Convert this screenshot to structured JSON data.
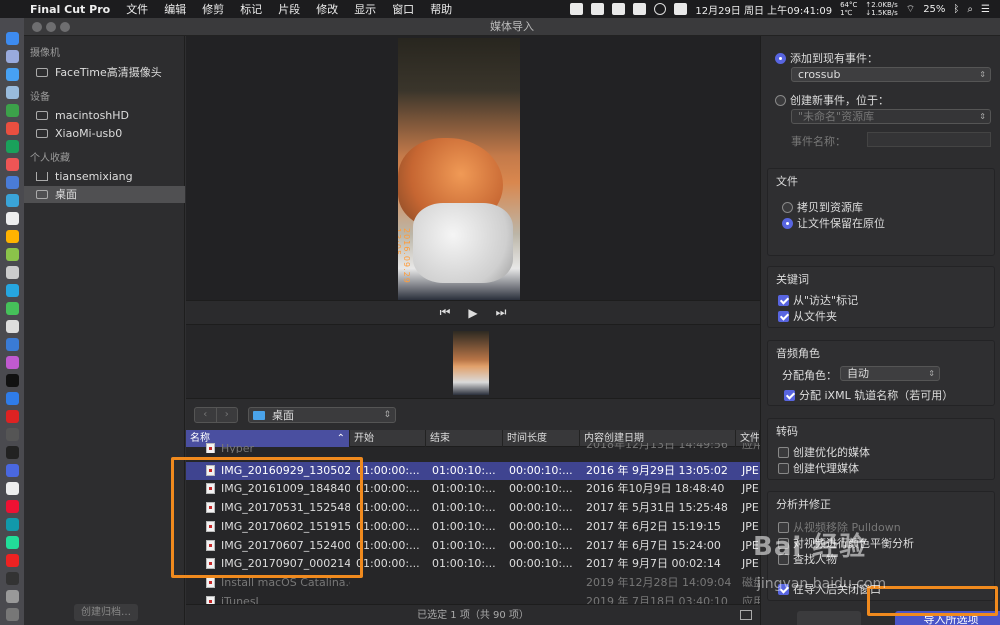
{
  "menubar": {
    "app_name": "Final Cut Pro",
    "items": [
      "文件",
      "编辑",
      "修剪",
      "标记",
      "片段",
      "修改",
      "显示",
      "窗口",
      "帮助"
    ],
    "temp": "64°C",
    "fan": "1℃",
    "net_up": "↑2.0KB/s",
    "net_down": "↓1.5KB/s",
    "datetime": "12月29日 周日 上午09:41:09",
    "battery": "25%"
  },
  "window": {
    "title": "媒体导入"
  },
  "sidebar": {
    "sections": [
      {
        "heading": "摄像机",
        "items": [
          {
            "label": "FaceTime高清摄像头",
            "icon": "camera-icon"
          }
        ]
      },
      {
        "heading": "设备",
        "items": [
          {
            "label": "macintoshHD",
            "icon": "drive-icon"
          },
          {
            "label": "XiaoMi-usb0",
            "icon": "drive-icon"
          }
        ]
      },
      {
        "heading": "个人收藏",
        "items": [
          {
            "label": "tiansemixiang",
            "icon": "home-icon"
          },
          {
            "label": "桌面",
            "icon": "desktop-icon",
            "selected": true
          }
        ]
      }
    ],
    "footer_button": "创建归档…"
  },
  "preview": {
    "date_stamp": "2016.09.29 13:05"
  },
  "transport": {
    "prev": "⏮",
    "play": "▶",
    "next": "⏭"
  },
  "browser": {
    "back": "‹",
    "forward": "›",
    "folder": "桌面",
    "columns": [
      "名称",
      "开始",
      "结束",
      "时间长度",
      "内容创建日期",
      "文件"
    ],
    "rows": [
      {
        "name": "Hyper",
        "start": "",
        "end": "",
        "duration": "",
        "date": "2018年12月13日 14:49:56",
        "type": "应用",
        "dim": true
      },
      {
        "name": "IMG_20160929_130502...",
        "start": "01:00:00:...",
        "end": "01:00:10:...",
        "duration": "00:00:10:...",
        "date": "2016 年 9月29日 13:05:02",
        "type": "JPE",
        "selected": true
      },
      {
        "name": "IMG_20161009_184840...",
        "start": "01:00:00:...",
        "end": "01:00:10:...",
        "duration": "00:00:10:...",
        "date": "2016 年10月9日 18:48:40",
        "type": "JPE"
      },
      {
        "name": "IMG_20170531_152548_...",
        "start": "01:00:00:...",
        "end": "01:00:10:...",
        "duration": "00:00:10:...",
        "date": "2017 年 5月31日 15:25:48",
        "type": "JPE"
      },
      {
        "name": "IMG_20170602_151915_...",
        "start": "01:00:00:...",
        "end": "01:00:10:...",
        "duration": "00:00:10:...",
        "date": "2017 年 6月2日 15:19:15",
        "type": "JPE"
      },
      {
        "name": "IMG_20170607_152400_...",
        "start": "01:00:00:...",
        "end": "01:00:10:...",
        "duration": "00:00:10:...",
        "date": "2017 年 6月7日 15:24:00",
        "type": "JPE"
      },
      {
        "name": "IMG_20170907_000214_...",
        "start": "01:00:00:...",
        "end": "01:00:10:...",
        "duration": "00:00:10:...",
        "date": "2017 年 9月7日 00:02:14",
        "type": "JPE"
      },
      {
        "name": "Install macOS Catalina.d...",
        "start": "",
        "end": "",
        "duration": "",
        "date": "2019 年12月28日 14:09:04",
        "type": "磁盘",
        "dim": true
      },
      {
        "name": "iTunesL",
        "start": "",
        "end": "",
        "duration": "",
        "date": "2019 年 7月18日 03:40:10",
        "type": "应用",
        "dim": true
      }
    ],
    "status": "已选定 1 项（共 90 项）"
  },
  "options": {
    "add_to_event": "添加到现有事件：",
    "event_value": "crossub",
    "create_event": "创建新事件，位于：",
    "library_value": "\"未命名\"资源库",
    "event_name_label": "事件名称：",
    "files_title": "文件",
    "copy_to_library": "拷贝到资源库",
    "leave_in_place": "让文件保留在原位",
    "keywords_title": "关键词",
    "from_finder_tags": "从\"访达\"标记",
    "from_folders": "从文件夹",
    "audio_roles_title": "音频角色",
    "assign_roles": "分配角色：",
    "roles_value": "自动",
    "assign_ixml": "分配 iXML 轨道名称（若可用）",
    "transcode_title": "转码",
    "create_optimized": "创建优化的媒体",
    "create_proxy": "创建代理媒体",
    "analyze_title": "分析并修正",
    "remove_pulldown": "从视频移除 Pulldown",
    "balance_color": "对视频进行颜色平衡分析",
    "find_people": "查找人物",
    "partial_hidden": "在导入后关闭窗口",
    "import_button": "导入所选项"
  },
  "watermark": {
    "logo": "Bai 经验",
    "url": "jingyan.baidu.com"
  },
  "colors": {
    "accent": "#5865e0",
    "highlight": "#f08a1e",
    "selection": "#3f4490"
  }
}
